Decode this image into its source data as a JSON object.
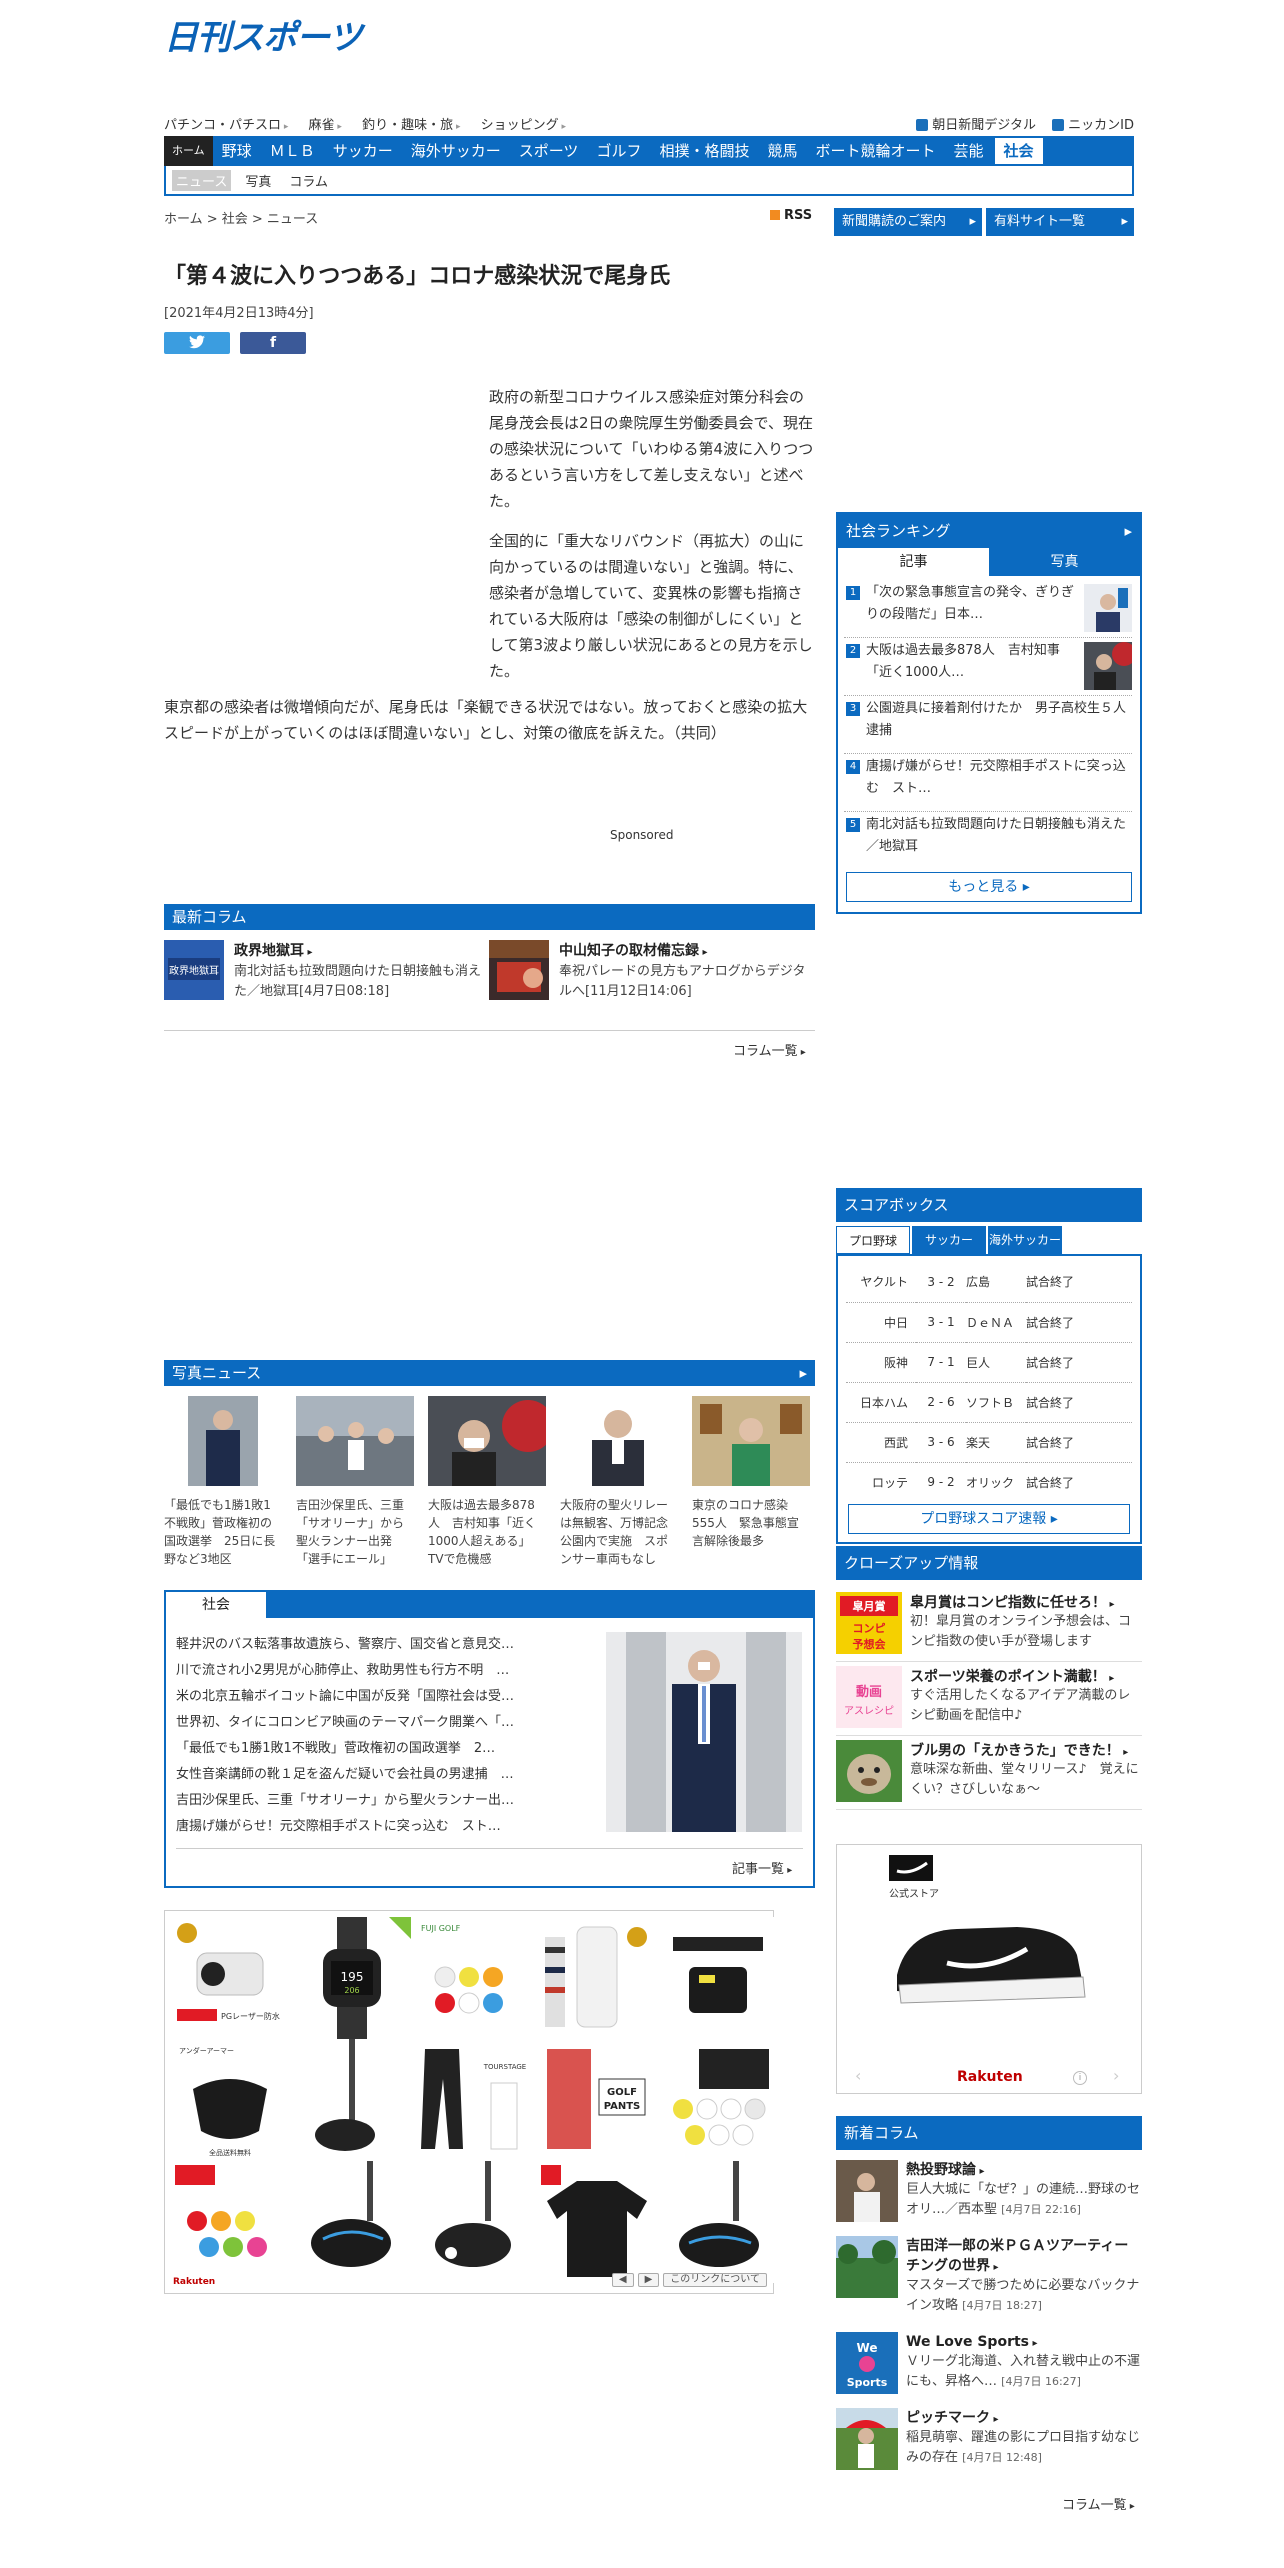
{
  "site": {
    "logo": "日刊スポーツ"
  },
  "subnav": {
    "left": [
      "パチンコ・パチスロ",
      "麻雀",
      "釣り・趣味・旅",
      "ショッピング"
    ],
    "right": [
      "朝日新聞デジタル",
      "ニッカンID"
    ]
  },
  "mainnav": {
    "home": "ホーム",
    "items": [
      "野球",
      "ＭＬＢ",
      "サッカー",
      "海外サッカー",
      "スポーツ",
      "ゴルフ",
      "相撲・格闘技",
      "競馬",
      "ボート競輪オート",
      "芸能"
    ],
    "active": "社会"
  },
  "subbar": {
    "items": [
      "ニュース",
      "写真",
      "コラム"
    ]
  },
  "breadcrumb": "ホーム > 社会 > ニュース",
  "rss": "RSS",
  "toplinks": [
    "新聞購読のご案内",
    "有料サイト一覧"
  ],
  "article": {
    "title": "「第４波に入りつつある」コロナ感染状況で尾身氏",
    "date": "[2021年4月2日13時4分]",
    "share_twitter": "",
    "share_facebook": "f",
    "p1": "政府の新型コロナウイルス感染症対策分科会の尾身茂会長は2日の衆院厚生労働委員会で、現在の感染状況について「いわゆる第4波に入りつつあるという言い方をして差し支えない」と述べた。",
    "p2a": "全国的に「重大なリバウンド（再拡大）の山に向かっているのは間違いない」と強調。特に、感染者が急増していて、変異株の影響も指摘されている大阪府は「感染の制御がしにくい」として第3波より厳しい状況にあるとの見方を示した。",
    "p3": "東京都の感染者は微増傾向だが、尾身氏は「楽観できる状況ではない。放っておくと感染の拡大スピードが上がっていくのはほぼ間違いない」とし、対策の徹底を訴えた。（共同）",
    "sponsored": "Sponsored"
  },
  "columns": {
    "header": "最新コラム",
    "items": [
      {
        "name": "政界地獄耳",
        "text": "南北対話も拉致問題向けた日朝接触も消えた／地獄耳[4月7日08:18]"
      },
      {
        "name": "中山知子の取材備忘録",
        "text": "奉祝パレードの見方もアナログからデジタルへ[11月12日14:06]"
      }
    ],
    "more": "コラム一覧"
  },
  "photo_news": {
    "header": "写真ニュース",
    "items": [
      "「最低でも1勝1敗1不戦敗」菅政権初の国政選挙　25日に長野など3地区",
      "吉田沙保里氏、三重「サオリーナ」から聖火ランナー出発「選手にエール」",
      "大阪は過去最多878人　吉村知事「近く1000人超えある」TVで危機感",
      "大阪府の聖火リレーは無観客、万博記念公園内で実施　スポンサー車両もなし",
      "東京のコロナ感染555人　緊急事態宣言解除後最多"
    ]
  },
  "social_box": {
    "tab": "社会",
    "items": [
      "軽井沢のバス転落事故遺族ら、警察庁、国交省と意見交…",
      "川で流され小2男児が心肺停止、救助男性も行方不明　…",
      "米の北京五輪ボイコット論に中国が反発「国際社会は受…",
      "世界初、タイにコロンビア映画のテーマパーク開業へ「…",
      "「最低でも1勝1敗1不戦敗」菅政権初の国政選挙　2…",
      "女性音楽講師の靴１足を盗んだ疑いで会社員の男逮捕　…",
      "吉田沙保里氏、三重「サオリーナ」から聖火ランナー出…",
      "唐揚げ嫌がらせ！元交際相手ポストに突っ込む　スト…"
    ],
    "more": "記事一覧"
  },
  "shop": {
    "prev": "◀",
    "next": "▶",
    "about": "このリンクについて",
    "brand": "Rakuten"
  },
  "ranking": {
    "header": "社会ランキング",
    "tabs": [
      "記事",
      "写真"
    ],
    "items": [
      {
        "num": "1",
        "text": "「次の緊急事態宣言の発令、ぎりぎりの段階だ」日本…"
      },
      {
        "num": "2",
        "text": "大阪は過去最多878人　吉村知事「近く1000人…"
      },
      {
        "num": "3",
        "text": "公園遊具に接着剤付けたか　男子高校生５人逮捕"
      },
      {
        "num": "4",
        "text": "唐揚げ嫌がらせ！元交際相手ポストに突っ込む　スト…"
      },
      {
        "num": "5",
        "text": "南北対話も拉致問題向けた日朝接触も消えた／地獄耳"
      }
    ],
    "more": "もっと見る"
  },
  "scorebox": {
    "header": "スコアボックス",
    "tabs": [
      "プロ野球",
      "サッカー",
      "海外サッカー"
    ],
    "games": [
      {
        "home": "ヤクルト",
        "score": "3 - 2",
        "away": "広島",
        "status": "試合終了"
      },
      {
        "home": "中日",
        "score": "3 - 1",
        "away": "ＤｅＮＡ",
        "status": "試合終了"
      },
      {
        "home": "阪神",
        "score": "7 - 1",
        "away": "巨人",
        "status": "試合終了"
      },
      {
        "home": "日本ハム",
        "score": "2 - 6",
        "away": "ソフトＢ",
        "status": "試合終了"
      },
      {
        "home": "西武",
        "score": "3 - 6",
        "away": "楽天",
        "status": "試合終了"
      },
      {
        "home": "ロッテ",
        "score": "9 - 2",
        "away": "オリック",
        "status": "試合終了"
      }
    ],
    "button": "プロ野球スコア速報"
  },
  "closeup": {
    "header": "クローズアップ情報",
    "items": [
      {
        "title": "皐月賞はコンピ指数に任せろ！",
        "text": "初！皐月賞のオンライン予想会は、コンピ指数の使い手が登場します"
      },
      {
        "title": "スポーツ栄養のポイント満載！",
        "text": "すぐ活用したくなるアイデア満載のレシピ動画を配信中♪"
      },
      {
        "title": "ブル男の「えかきうた」できた！",
        "text": "意味深な新曲、堂々リリース♪　覚えにくい？さびしいなぁ～"
      }
    ]
  },
  "ad": {
    "label": "公式ストア",
    "brand": "Rakuten"
  },
  "newcolumns": {
    "header": "新着コラム",
    "items": [
      {
        "title": "熱投野球論",
        "text": "巨人大城に「なぜ？」の連続…野球のセオリ…／西本聖",
        "date": "[4月7日 22:16]"
      },
      {
        "title": "吉田洋一郎の米ＰＧＡツアーティーチングの世界",
        "text": "マスターズで勝つために必要なバックナイン攻略",
        "date": "[4月7日 18:27]"
      },
      {
        "title": "We Love Sports",
        "text": "Ｖリーグ北海道、入れ替え戦中止の不運にも、昇格へ…",
        "date": "[4月7日 16:27]"
      },
      {
        "title": "ピッチマーク",
        "text": "稲見萌寧、躍進の影にプロ目指す幼なじみの存在",
        "date": "[4月7日 12:48]"
      }
    ],
    "more": "コラム一覧"
  }
}
